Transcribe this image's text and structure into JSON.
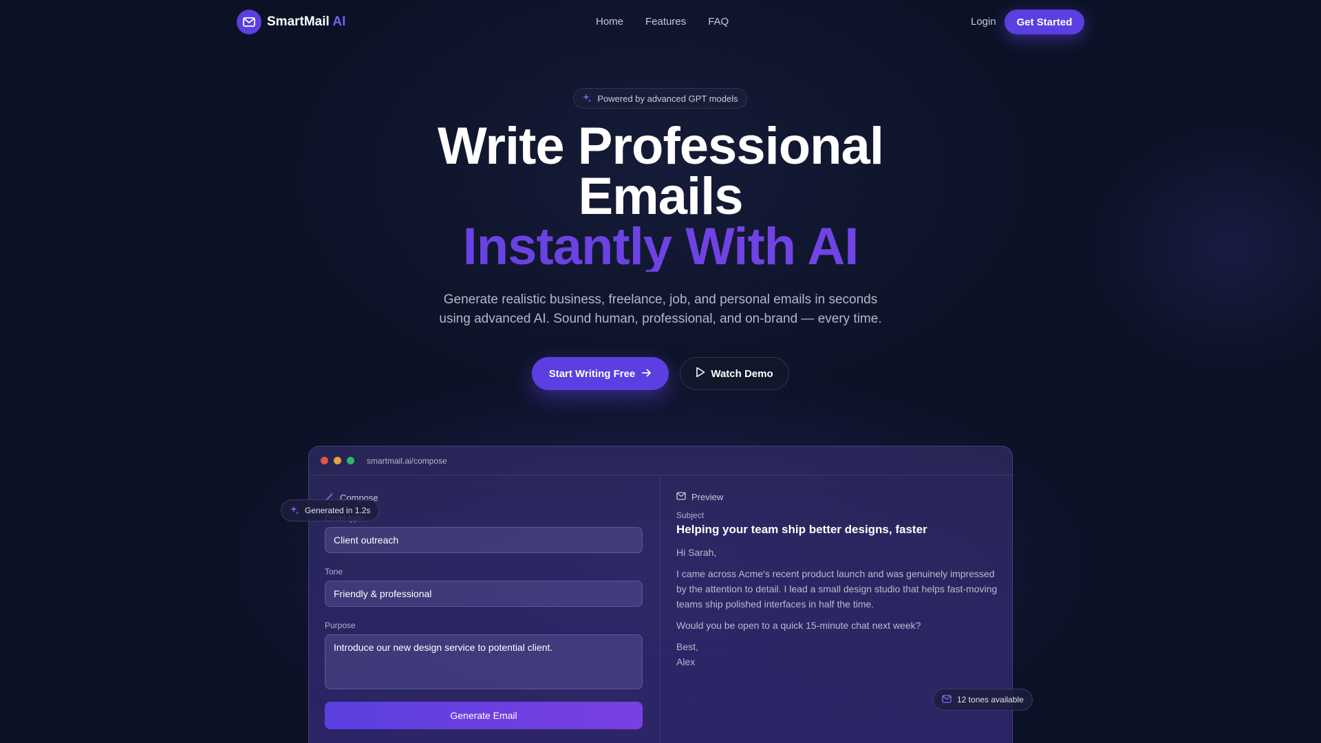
{
  "nav": {
    "brand_name": "SmartMail",
    "brand_suffix": "AI",
    "links": [
      "Home",
      "Features",
      "FAQ"
    ],
    "login": "Login",
    "get_started": "Get Started"
  },
  "hero": {
    "badge": "Powered by advanced GPT models",
    "title_line1": "Write Professional",
    "title_line2": "Emails",
    "title_line3": "Instantly With AI",
    "subtitle_line1": "Generate realistic business, freelance, job, and personal emails in seconds",
    "subtitle_line2": "using advanced AI. Sound human, professional, and on-brand — every time.",
    "cta_primary": "Start Writing Free",
    "cta_secondary": "Watch Demo"
  },
  "app": {
    "url": "smartmail.ai/compose",
    "compose_title": "Compose",
    "generated_chip": "Generated in 1.2s",
    "email_type_label": "Email type",
    "email_type_value": "Client outreach",
    "tone_label": "Tone",
    "tone_value": "Friendly & professional",
    "purpose_label": "Purpose",
    "purpose_value": "Introduce our new design service to potential client.",
    "generate_button": "Generate Email",
    "preview_title": "Preview",
    "subject_label": "Subject",
    "subject_value": "Helping your team ship better designs, faster",
    "greeting": "Hi Sarah,",
    "body_paragraph": "I came across Acme's recent product launch and was genuinely impressed by the attention to detail. I lead a small design studio that helps fast-moving teams ship polished interfaces in half the time.",
    "question": "Would you be open to a quick 15-minute chat next week?",
    "signoff": "Best,",
    "signature": "Alex",
    "tones_chip": "12 tones available"
  },
  "colors": {
    "accent": "#5b3fe0",
    "background": "#0c1226",
    "dot_red": "#e0534f",
    "dot_yellow": "#e0a43a",
    "dot_green": "#2fb86a"
  },
  "icons": {
    "logo": "mail-icon",
    "badge": "sparkles-icon",
    "cta_primary": "arrow-right-icon",
    "cta_secondary": "play-icon",
    "compose": "magic-wand-icon",
    "preview": "mail-icon"
  }
}
